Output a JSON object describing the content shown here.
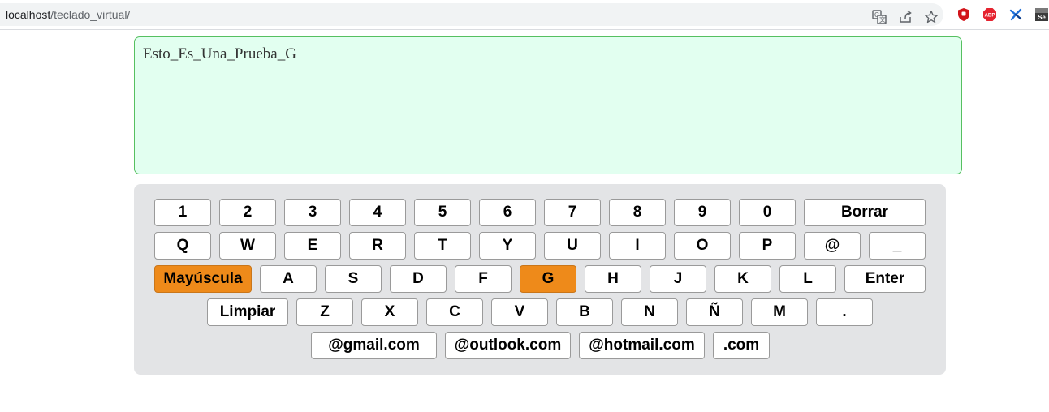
{
  "browser": {
    "url_host": "localhost",
    "url_path": "/teclado_virtual/"
  },
  "text_area": {
    "value": "Esto_Es_Una_Prueba_G"
  },
  "keyboard": {
    "row1": [
      "1",
      "2",
      "3",
      "4",
      "5",
      "6",
      "7",
      "8",
      "9",
      "0",
      "Borrar"
    ],
    "row2": [
      "Q",
      "W",
      "E",
      "R",
      "T",
      "Y",
      "U",
      "I",
      "O",
      "P",
      "@",
      "_"
    ],
    "row3": [
      "Mayúscula",
      "A",
      "S",
      "D",
      "F",
      "G",
      "H",
      "J",
      "K",
      "L",
      "Enter"
    ],
    "row4": [
      "Limpiar",
      "Z",
      "X",
      "C",
      "V",
      "B",
      "N",
      "Ñ",
      "M",
      "."
    ],
    "row5": [
      "@gmail.com",
      "@outlook.com",
      "@hotmail.com",
      ".com"
    ],
    "active_keys": [
      "Mayúscula",
      "G"
    ],
    "active_color": "#ee8a1a"
  },
  "icons": {
    "omnibox": [
      "translate-icon",
      "share-icon",
      "star-icon"
    ],
    "extensions": [
      "ublock-icon",
      "adblock-plus-icon",
      "puzzle-extension-icon",
      "selenium-icon"
    ]
  }
}
